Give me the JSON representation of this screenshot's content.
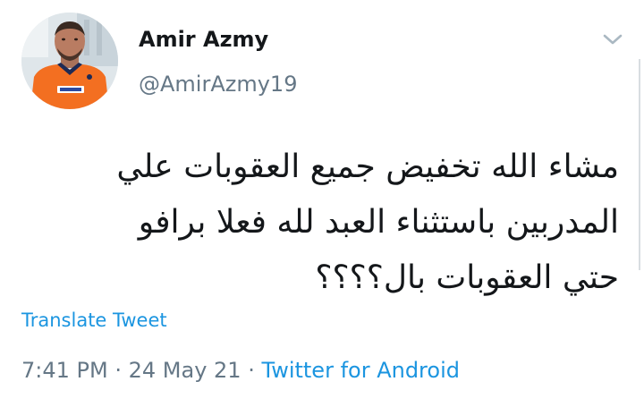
{
  "author": {
    "display_name": "Amir Azmy",
    "handle": "@AmirAzmy19",
    "avatar_icon": "profile-photo"
  },
  "tweet": {
    "text_lines": [
      "مشاء الله  تخفيض جميع العقوبات علي",
      "المدربين باستثناء العبد لله فعلا  برافو",
      "حتي العقوبات بال؟؟؟؟"
    ],
    "translate_label": "Translate Tweet",
    "time": "7:41 PM",
    "separator": "·",
    "date": "24 May 21",
    "source": "Twitter for Android"
  },
  "icons": {
    "menu": "chevron-down-icon"
  },
  "colors": {
    "link": "#1b95e0",
    "secondary_text": "#657786",
    "primary_text": "#14171a",
    "jersey": "#f36f21"
  }
}
